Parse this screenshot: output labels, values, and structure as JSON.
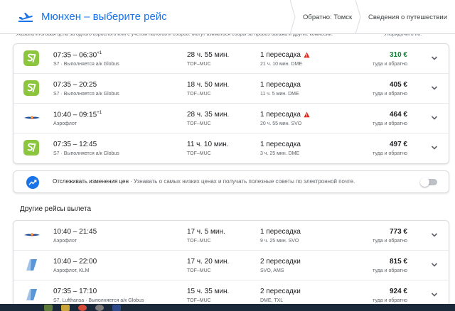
{
  "header": {
    "title": "Мюнхен – выберите рейс",
    "tab_return": "Обратно: Томск",
    "tab_trip": "Сведения о путешествии"
  },
  "cut_notice": "Указана итоговая цена за одного взрослого или с учетом налогов и сборов. Могут взиматься сборы за провоз багажа и другие комиссии.",
  "cut_sort": "Упорядочить по:",
  "best_flights": [
    {
      "logo": "s7",
      "dep": "07:35",
      "arr": "06:30",
      "arr_sup": "+1",
      "airline": "S7 · Выполняется а/к Globus",
      "duration": "28 ч. 55 мин.",
      "route": "TOF–MUC",
      "stops": "1 пересадка",
      "warning": true,
      "stop_info": "21 ч. 10 мин. DME",
      "price": "310 €",
      "price_green": true,
      "price_type": "туда и обратно"
    },
    {
      "logo": "s7",
      "dep": "07:35",
      "arr": "20:25",
      "arr_sup": "",
      "airline": "S7 · Выполняется а/к Globus",
      "duration": "18 ч. 50 мин.",
      "route": "TOF–MUC",
      "stops": "1 пересадка",
      "warning": false,
      "stop_info": "11 ч. 5 мин. DME",
      "price": "405 €",
      "price_green": false,
      "price_type": "туда и обратно"
    },
    {
      "logo": "aeroflot",
      "dep": "10:40",
      "arr": "09:15",
      "arr_sup": "+1",
      "airline": "Аэрофлот",
      "duration": "28 ч. 35 мин.",
      "route": "TOF–MUC",
      "stops": "1 пересадка",
      "warning": true,
      "stop_info": "20 ч. 55 мин. SVO",
      "price": "464 €",
      "price_green": false,
      "price_type": "туда и обратно"
    },
    {
      "logo": "s7",
      "dep": "07:35",
      "arr": "12:45",
      "arr_sup": "",
      "airline": "S7 · Выполняется а/к Globus",
      "duration": "11 ч. 10 мин.",
      "route": "TOF–MUC",
      "stops": "1 пересадка",
      "warning": false,
      "stop_info": "3 ч. 25 мин. DME",
      "price": "497 €",
      "price_green": false,
      "price_type": "туда и обратно"
    }
  ],
  "tracker": {
    "bold": "Отслеживать изменения цен",
    "text": " · Узнавать о самых низких ценах и получать полезные советы по электронной почте.",
    "enabled": false
  },
  "other_title": "Другие рейсы вылета",
  "other_flights": [
    {
      "logo": "aeroflot",
      "dep": "10:40",
      "arr": "21:45",
      "arr_sup": "",
      "airline": "Аэрофлот",
      "duration": "17 ч. 5 мин.",
      "route": "TOF–MUC",
      "stops": "1 пересадка",
      "warning": false,
      "stop_info": "9 ч. 25 мин. SVO",
      "price": "773 €",
      "price_green": false,
      "price_type": "туда и обратно"
    },
    {
      "logo": "multi",
      "dep": "10:40",
      "arr": "22:00",
      "arr_sup": "",
      "airline": "Аэрофлот, KLM",
      "duration": "17 ч. 20 мин.",
      "route": "TOF–MUC",
      "stops": "2 пересадки",
      "warning": false,
      "stop_info": "SVO, AMS",
      "price": "815 €",
      "price_green": false,
      "price_type": "туда и обратно"
    },
    {
      "logo": "multi",
      "dep": "07:35",
      "arr": "17:10",
      "arr_sup": "",
      "airline": "S7, Lufthansa · Выполняется а/к Globus",
      "duration": "15 ч. 35 мин.",
      "route": "TOF–MUC",
      "stops": "2 пересадки",
      "warning": false,
      "stop_info": "DME, TXL",
      "price": "924 €",
      "price_green": false,
      "price_type": "туда и обратно"
    }
  ],
  "colors": {
    "accent": "#1a73e8",
    "s7": "#8cc63f",
    "green_price": "#188038",
    "warning": "#d93025"
  }
}
